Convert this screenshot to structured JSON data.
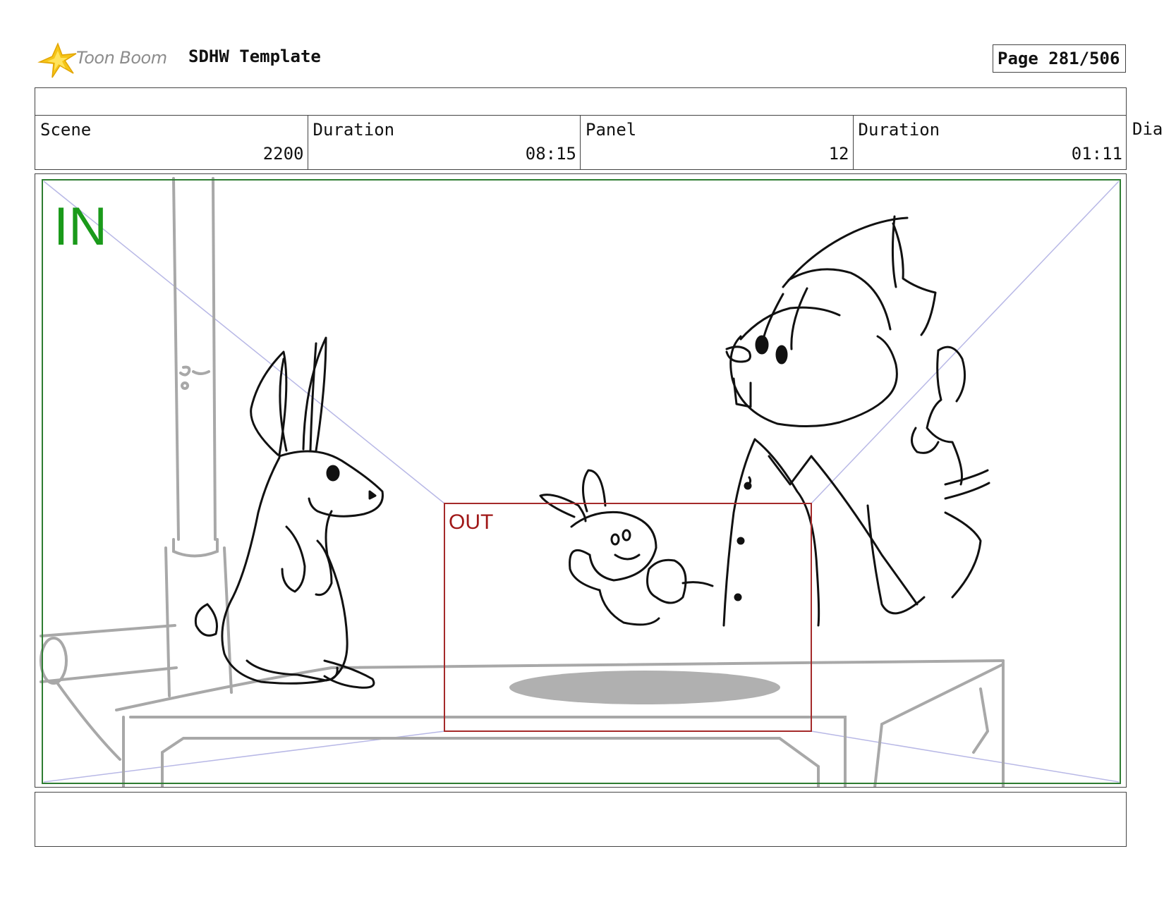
{
  "header": {
    "brand": "Toon Boom",
    "title": "SDHW Template",
    "page": "Page 281/506"
  },
  "info": {
    "scene_label": "Scene",
    "scene_value": "2200",
    "duration_label": "Duration",
    "duration_value": "08:15",
    "panel_label": "Panel",
    "panel_value": "12",
    "panel_duration_label": "Duration",
    "panel_duration_value": "01:11",
    "dialogue_label": "Dia"
  },
  "panel": {
    "in_label": "IN",
    "out_label": "OUT",
    "in_color": "#1a9a1a",
    "out_color": "#a01818"
  },
  "colors": {
    "in_frame": "#2e7d32",
    "out_frame": "#a52a2a",
    "guide": "#b8b8e6",
    "sketch": "#111111",
    "background_sketch": "#a8a8a8"
  }
}
